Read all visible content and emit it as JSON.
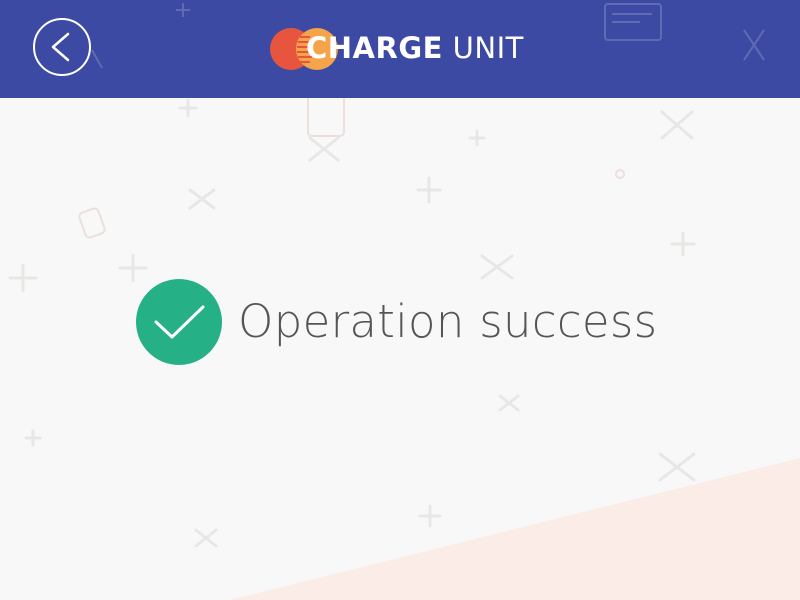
{
  "header": {
    "back_button_icon": "chevron-left-icon",
    "logo": {
      "mark_icon": "charge-unit-logo-icon",
      "text_bold": "CHARGE",
      "text_light": " UNIT"
    }
  },
  "main": {
    "status_icon": "checkmark-circle-icon",
    "status_text": "Operation success"
  },
  "colors": {
    "header_bg": "#3d4aa3",
    "page_bg": "#f8f8f8",
    "success_green": "#26b086",
    "text_gray": "#555555",
    "logo_red": "#e8553f",
    "logo_orange": "#f5a44a",
    "bottom_shape": "#fbece8"
  }
}
